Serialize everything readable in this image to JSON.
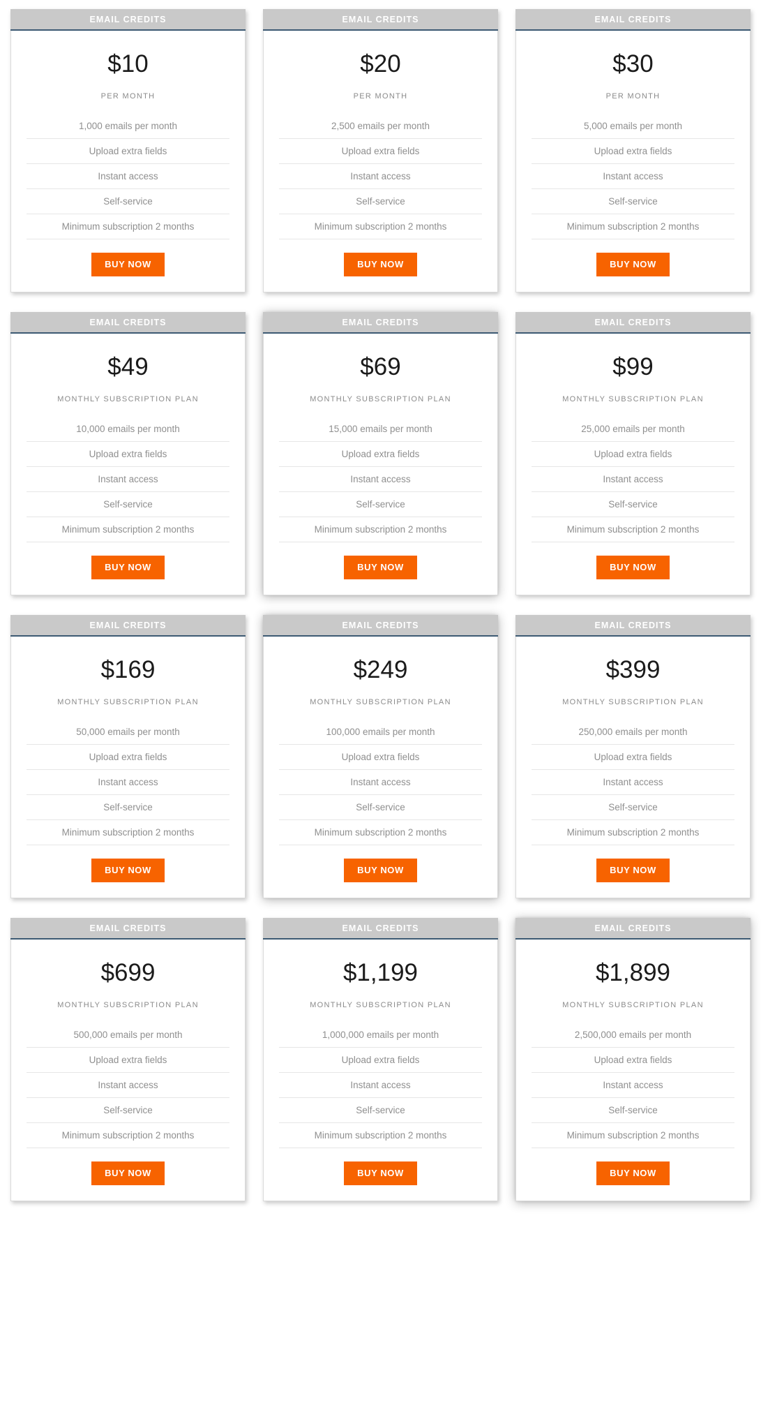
{
  "page": {
    "background_color": "#ffffff",
    "accent_color": "#f76300",
    "header_bar_color": "#c9c9c9",
    "header_rule_color": "#3d5a73"
  },
  "common": {
    "header_label": "EMAIL CREDITS",
    "buy_label": "BUY NOW",
    "feature_upload": "Upload extra fields",
    "feature_instant": "Instant access",
    "feature_self": "Self-service",
    "feature_minimum": "Minimum subscription 2 months",
    "period_per_month": "PER MONTH",
    "period_monthly_plan": "MONTHLY SUBSCRIPTION PLAN"
  },
  "plans": [
    {
      "header": "EMAIL CREDITS",
      "price": "$10",
      "period": "PER MONTH",
      "features": [
        "1,000 emails per month",
        "Upload extra fields",
        "Instant access",
        "Self-service",
        "Minimum subscription 2 months"
      ],
      "buy_label": "BUY NOW",
      "elevated": false
    },
    {
      "header": "EMAIL CREDITS",
      "price": "$20",
      "period": "PER MONTH",
      "features": [
        "2,500 emails per month",
        "Upload extra fields",
        "Instant access",
        "Self-service",
        "Minimum subscription 2 months"
      ],
      "buy_label": "BUY NOW",
      "elevated": false
    },
    {
      "header": "EMAIL CREDITS",
      "price": "$30",
      "period": "PER MONTH",
      "features": [
        "5,000 emails per month",
        "Upload extra fields",
        "Instant access",
        "Self-service",
        "Minimum subscription 2 months"
      ],
      "buy_label": "BUY NOW",
      "elevated": false
    },
    {
      "header": "EMAIL CREDITS",
      "price": "$49",
      "period": "MONTHLY SUBSCRIPTION PLAN",
      "features": [
        "10,000 emails per month",
        "Upload extra fields",
        "Instant access",
        "Self-service",
        "Minimum subscription 2 months"
      ],
      "buy_label": "BUY NOW",
      "elevated": false
    },
    {
      "header": "EMAIL CREDITS",
      "price": "$69",
      "period": "MONTHLY SUBSCRIPTION PLAN",
      "features": [
        "15,000 emails per month",
        "Upload extra fields",
        "Instant access",
        "Self-service",
        "Minimum subscription 2 months"
      ],
      "buy_label": "BUY NOW",
      "elevated": true
    },
    {
      "header": "EMAIL CREDITS",
      "price": "$99",
      "period": "MONTHLY SUBSCRIPTION PLAN",
      "features": [
        "25,000 emails per month",
        "Upload extra fields",
        "Instant access",
        "Self-service",
        "Minimum subscription 2 months"
      ],
      "buy_label": "BUY NOW",
      "elevated": false
    },
    {
      "header": "EMAIL CREDITS",
      "price": "$169",
      "period": "MONTHLY SUBSCRIPTION PLAN",
      "features": [
        "50,000 emails per month",
        "Upload extra fields",
        "Instant access",
        "Self-service",
        "Minimum subscription 2 months"
      ],
      "buy_label": "BUY NOW",
      "elevated": false
    },
    {
      "header": "EMAIL CREDITS",
      "price": "$249",
      "period": "MONTHLY SUBSCRIPTION PLAN",
      "features": [
        "100,000 emails per month",
        "Upload extra fields",
        "Instant access",
        "Self-service",
        "Minimum subscription 2 months"
      ],
      "buy_label": "BUY NOW",
      "elevated": true
    },
    {
      "header": "EMAIL CREDITS",
      "price": "$399",
      "period": "MONTHLY SUBSCRIPTION PLAN",
      "features": [
        "250,000 emails per month",
        "Upload extra fields",
        "Instant access",
        "Self-service",
        "Minimum subscription 2 months"
      ],
      "buy_label": "BUY NOW",
      "elevated": false
    },
    {
      "header": "EMAIL CREDITS",
      "price": "$699",
      "period": "MONTHLY SUBSCRIPTION PLAN",
      "features": [
        "500,000 emails per month",
        "Upload extra fields",
        "Instant access",
        "Self-service",
        "Minimum subscription 2 months"
      ],
      "buy_label": "BUY NOW",
      "elevated": false
    },
    {
      "header": "EMAIL CREDITS",
      "price": "$1,199",
      "period": "MONTHLY SUBSCRIPTION PLAN",
      "features": [
        "1,000,000 emails per month",
        "Upload extra fields",
        "Instant access",
        "Self-service",
        "Minimum subscription 2 months"
      ],
      "buy_label": "BUY NOW",
      "elevated": false
    },
    {
      "header": "EMAIL CREDITS",
      "price": "$1,899",
      "period": "MONTHLY SUBSCRIPTION PLAN",
      "features": [
        "2,500,000 emails per month",
        "Upload extra fields",
        "Instant access",
        "Self-service",
        "Minimum subscription 2 months"
      ],
      "buy_label": "BUY NOW",
      "elevated": true
    }
  ]
}
